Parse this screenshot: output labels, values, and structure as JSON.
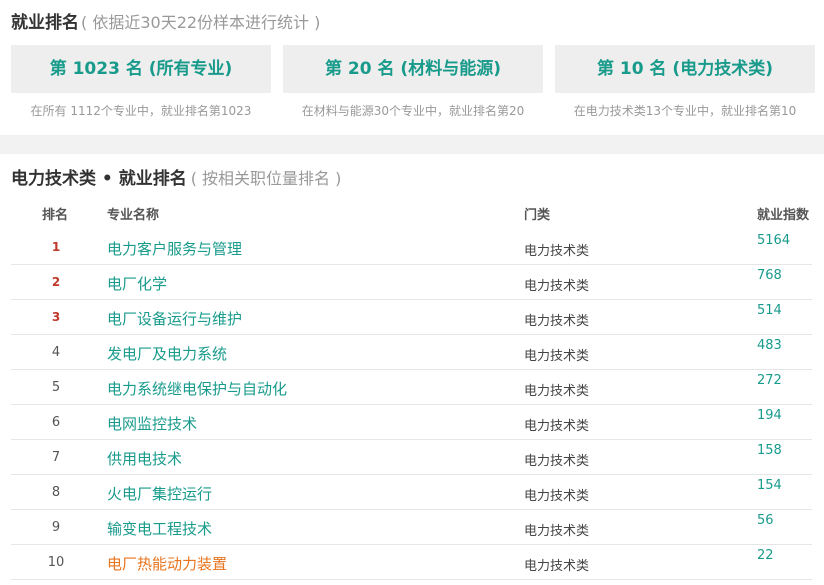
{
  "summary": {
    "title": "就业排名",
    "subtitle": "( 依据近30天22份样本进行统计 )",
    "cards": [
      {
        "label": "第 1023 名 (所有专业)",
        "desc": "在所有 1112个专业中，就业排名第1023"
      },
      {
        "label": "第 20 名 (材料与能源)",
        "desc": "在材料与能源30个专业中，就业排名第20"
      },
      {
        "label": "第 10 名 (电力技术类)",
        "desc": "在电力技术类13个专业中，就业排名第10"
      }
    ]
  },
  "ranking": {
    "title": "电力技术类 • 就业排名",
    "subtitle": "( 按相关职位量排名 )",
    "columns": {
      "rank": "排名",
      "name": "专业名称",
      "category": "门类",
      "index": "就业指数"
    },
    "rows": [
      {
        "rank": "1",
        "name": "电力客户服务与管理",
        "category": "电力技术类",
        "index": "5164"
      },
      {
        "rank": "2",
        "name": "电厂化学",
        "category": "电力技术类",
        "index": "768"
      },
      {
        "rank": "3",
        "name": "电厂设备运行与维护",
        "category": "电力技术类",
        "index": "514"
      },
      {
        "rank": "4",
        "name": "发电厂及电力系统",
        "category": "电力技术类",
        "index": "483"
      },
      {
        "rank": "5",
        "name": "电力系统继电保护与自动化",
        "category": "电力技术类",
        "index": "272"
      },
      {
        "rank": "6",
        "name": "电网监控技术",
        "category": "电力技术类",
        "index": "194"
      },
      {
        "rank": "7",
        "name": "供用电技术",
        "category": "电力技术类",
        "index": "158"
      },
      {
        "rank": "8",
        "name": "火电厂集控运行",
        "category": "电力技术类",
        "index": "154"
      },
      {
        "rank": "9",
        "name": "输变电工程技术",
        "category": "电力技术类",
        "index": "56"
      },
      {
        "rank": "10",
        "name": "电厂热能动力装置",
        "category": "电力技术类",
        "index": "22"
      }
    ]
  },
  "colors": {
    "accent": "#199b8c",
    "top_rank": "#c0392b",
    "highlight": "#e8741e"
  }
}
